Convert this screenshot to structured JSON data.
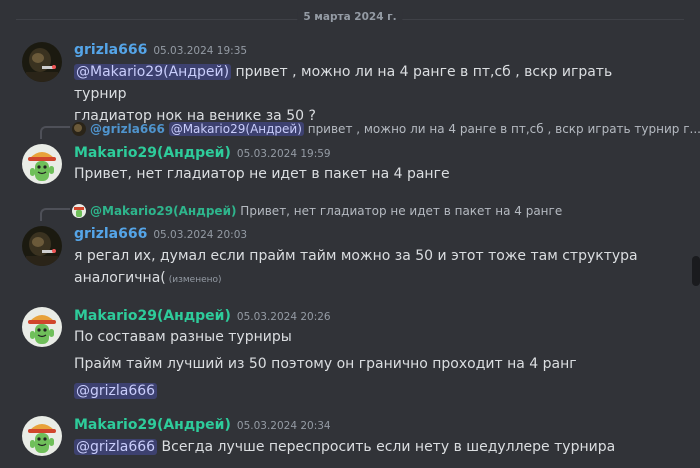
{
  "date_divider": "5 марта 2024 г.",
  "messages": [
    {
      "author": "grizla666",
      "time": "05.03.2024 19:35",
      "mention": "@Makario29(Андрей)",
      "line1": " привет , можно ли на 4 ранге в пт,сб , вскр играть турнир",
      "line2": "гладиатор нок на венике за 50 ?"
    },
    {
      "reply_author": "@grizla666",
      "reply_mention": "@Makario29(Андрей)",
      "reply_text": " привет , можно ли на 4 ранге в пт,сб , вскр играть турнир г...",
      "author": "Makario29(Андрей)",
      "time": "05.03.2024 19:59",
      "text": "Привет, нет гладиатор не идет в пакет на 4 ранге"
    },
    {
      "reply_author": "@Makario29(Андрей)",
      "reply_text": "Привет, нет гладиатор не идет в пакет на 4 ранге",
      "author": "grizla666",
      "time": "05.03.2024 20:03",
      "line1": "я регал их, думал если прайм тайм можно за 50 и этот тоже там структура",
      "line2": "аналогична(",
      "edited": "(изменено)"
    },
    {
      "author": "Makario29(Андрей)",
      "time": "05.03.2024 20:26",
      "line1": "По составам разные турниры",
      "line2": "Прайм тайм лучший из 50 поэтому он гранично проходит на 4 ранг",
      "mention": "@grizla666"
    },
    {
      "author": "Makario29(Андрей)",
      "time": "05.03.2024 20:34",
      "mention": "@grizla666",
      "text": " Всегда лучше переспросить если нету в шедуллере турнира"
    }
  ],
  "colors": {
    "background": "#313338",
    "author_grizla": "#55a5e8",
    "author_makario": "#2ecc9b",
    "mention_bg": "#3c4270"
  }
}
